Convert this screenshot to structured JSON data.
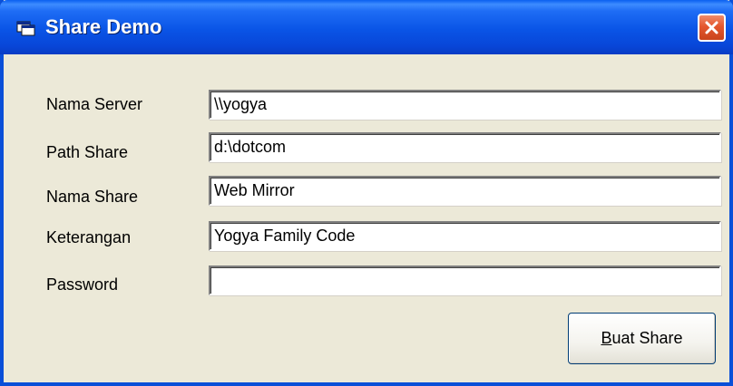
{
  "window": {
    "title": "Share Demo",
    "icon": "form-window-icon",
    "close_icon": "close-icon",
    "close_color": "#e4572e",
    "titlebar_color": "#0a54e6"
  },
  "form": {
    "fields": [
      {
        "label": "Nama Server",
        "value": "\\\\yogya"
      },
      {
        "label": "Path Share",
        "value": "d:\\dotcom"
      },
      {
        "label": "Nama Share",
        "value": "Web Mirror"
      },
      {
        "label": "Keterangan",
        "value": "Yogya Family Code"
      },
      {
        "label": "Password",
        "value": ""
      }
    ],
    "submit": {
      "accel": "B",
      "rest": "uat Share"
    }
  }
}
